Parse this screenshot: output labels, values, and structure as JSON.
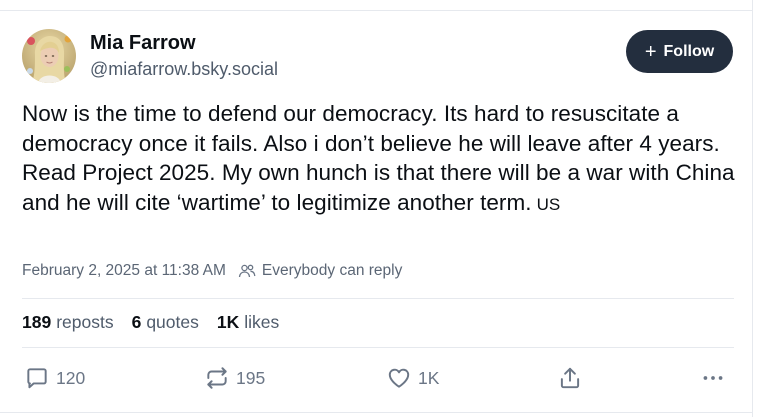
{
  "author": {
    "name": "Mia Farrow",
    "handle": "@miafarrow.bsky.social"
  },
  "follow_button": {
    "label": "Follow"
  },
  "post": {
    "text": "Now is the time to defend our democracy. Its hard to resuscitate a democracy once it fails. Also i don’t believe he will leave after 4 years.  Read Project 2025.   My own hunch is that there will be a war with China and he will cite ‘wartime’ to legitimize another term.",
    "language_tag": "US",
    "timestamp": "February 2, 2025 at 11:38 AM",
    "reply_setting": "Everybody can reply"
  },
  "stats": {
    "reposts_count": "189",
    "reposts_label": "reposts",
    "quotes_count": "6",
    "quotes_label": "quotes",
    "likes_count": "1K",
    "likes_label": "likes"
  },
  "actions": {
    "reply_count": "120",
    "repost_count": "195",
    "like_count": "1K"
  },
  "colors": {
    "follow_bg": "#232e3e",
    "muted_text": "#4f5b6b",
    "icon": "#6b7686",
    "divider": "#e6e9ee"
  }
}
